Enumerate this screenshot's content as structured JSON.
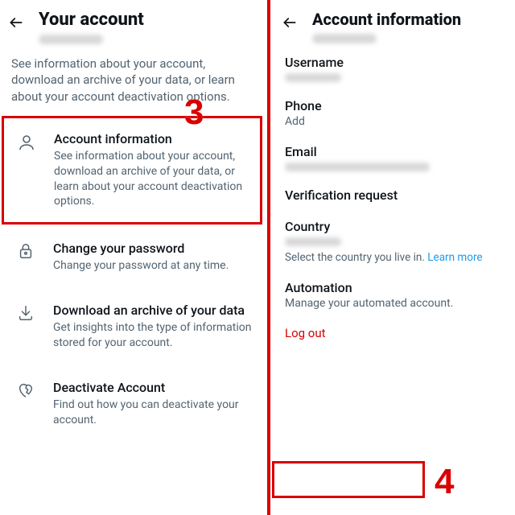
{
  "left": {
    "title": "Your account",
    "subtext": "See information about your account, download an archive of your data, or learn about your account deactivation options.",
    "items": [
      {
        "title": "Account information",
        "desc": "See information about your account, download an archive of your data, or learn about your account deactivation options."
      },
      {
        "title": "Change your password",
        "desc": "Change your password at any time."
      },
      {
        "title": "Download an archive of your data",
        "desc": "Get insights into the type of information stored for your account."
      },
      {
        "title": "Deactivate Account",
        "desc": "Find out how you can deactivate your account."
      }
    ]
  },
  "right": {
    "title": "Account information",
    "username_label": "Username",
    "phone_label": "Phone",
    "phone_value": "Add",
    "email_label": "Email",
    "verification_label": "Verification request",
    "country_label": "Country",
    "country_hint": "Select the country you live in. ",
    "learn_more": "Learn more",
    "automation_label": "Automation",
    "automation_hint": "Manage your automated account.",
    "logout": "Log out"
  },
  "annotations": {
    "step3": "3",
    "step4": "4"
  }
}
